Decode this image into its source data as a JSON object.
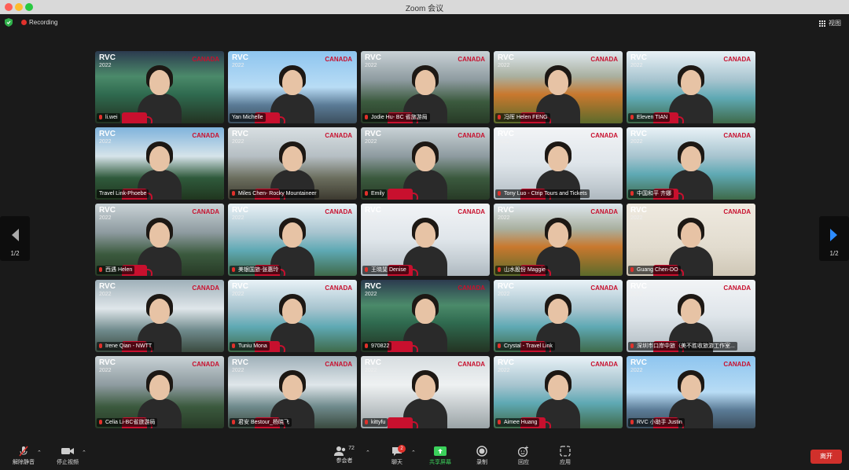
{
  "window": {
    "title": "Zoom 会议"
  },
  "topbar": {
    "recording": "Recording",
    "view_label": "视图"
  },
  "pagination": {
    "left_page": "1/2",
    "right_page": "1/2"
  },
  "branding": {
    "rvc": "RVC",
    "year": "2022",
    "brand": "CANADA"
  },
  "colors": {
    "accent_red": "#c8102e",
    "share_green": "#3bd15b",
    "leave_red": "#d0302b",
    "active_border": "#6ad16a"
  },
  "participants": [
    {
      "name": "li.wei",
      "muted": true,
      "bg": "aurora"
    },
    {
      "name": "Yan Michelle",
      "muted": false,
      "bg": "city"
    },
    {
      "name": "Jodie Hu- BC 省旅游局",
      "muted": true,
      "bg": "mountain"
    },
    {
      "name": "冯晖 Helen FENG",
      "muted": true,
      "bg": "autumn"
    },
    {
      "name": "Eleven TIAN",
      "muted": true,
      "bg": "lake"
    },
    {
      "name": "Travel Link-Phoebe",
      "muted": false,
      "bg": "forest",
      "active": true
    },
    {
      "name": "Miles Chen- Rocky Mountaineer",
      "muted": true,
      "bg": "train"
    },
    {
      "name": "Emily",
      "muted": true,
      "bg": "mountain"
    },
    {
      "name": "Tony Luo - Ctrip Tours and Tickets",
      "muted": true,
      "bg": "snow"
    },
    {
      "name": "中国和平 齐娜",
      "muted": true,
      "bg": "lake"
    },
    {
      "name": "西遇 Helen",
      "muted": true,
      "bg": "mountain"
    },
    {
      "name": "美银国旅-张惠玲",
      "muted": true,
      "bg": "lake"
    },
    {
      "name": "王晓斐 Denise",
      "muted": true,
      "bg": "snow"
    },
    {
      "name": "山水股份 Maggie",
      "muted": true,
      "bg": "autumn"
    },
    {
      "name": "Guang Chen-DO",
      "muted": true,
      "bg": "beige"
    },
    {
      "name": "Irene Qian - NWTT",
      "muted": true,
      "bg": "falls"
    },
    {
      "name": "Tuniu Mona",
      "muted": true,
      "bg": "lake"
    },
    {
      "name": "970822",
      "muted": true,
      "bg": "aurora"
    },
    {
      "name": "Crystal - Travel Link",
      "muted": true,
      "bg": "lake"
    },
    {
      "name": "深圳市口岸中旅（美不胜收旅游工作室...",
      "muted": true,
      "bg": "snow"
    },
    {
      "name": "Celia Li-BC省旅游局",
      "muted": true,
      "bg": "mountain"
    },
    {
      "name": "君安 Bestour_杨晓飞",
      "muted": true,
      "bg": "falls"
    },
    {
      "name": "kittyfu",
      "muted": true,
      "bg": "office"
    },
    {
      "name": "Aimee Huang",
      "muted": true,
      "bg": "lake"
    },
    {
      "name": "RVC 小助手 Justin",
      "muted": true,
      "bg": "city"
    }
  ],
  "toolbar": {
    "mute": "解除静音",
    "stop_video": "停止视频",
    "participants": "参会者",
    "participant_count": "72",
    "chat": "聊天",
    "chat_badge": "2",
    "share": "共享屏幕",
    "record": "录制",
    "reactions": "回应",
    "apps": "应用",
    "leave": "离开"
  }
}
